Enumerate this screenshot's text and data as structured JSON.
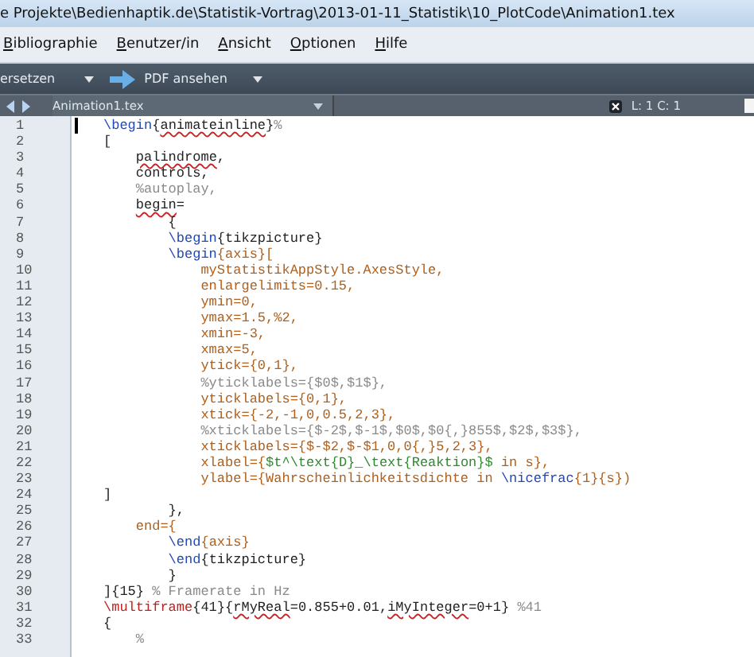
{
  "window": {
    "title": "e Projekte\\Bedienhaptik.de\\Statistik-Vortrag\\2013-01-11_Statistik\\10_PlotCode\\Animation1.tex"
  },
  "menu": [
    "Bibliographie",
    "Benutzer/in",
    "Ansicht",
    "Optionen",
    "Hilfe"
  ],
  "toolbar": [
    {
      "label": "ersetzen",
      "kind": "dropdown"
    },
    {
      "label": "PDF ansehen",
      "kind": "view"
    }
  ],
  "tab": {
    "label": "Animation1.tex",
    "position": "L: 1 C: 1"
  },
  "lines": [
    {
      "number": "1",
      "segments": [
        {
          "t": "\\begin",
          "kind": "cmd"
        },
        {
          "t": "{",
          "kind": "plain"
        },
        {
          "t": "animateinline",
          "kind": "error"
        },
        {
          "t": "}",
          "kind": "plain"
        },
        {
          "t": "%",
          "kind": "comment"
        }
      ]
    },
    {
      "number": "2",
      "segments": [
        {
          "t": "[",
          "kind": "plain"
        }
      ]
    },
    {
      "number": "3",
      "segments": [
        {
          "t": "    palindrome",
          "kind": "error"
        },
        {
          "t": ",",
          "kind": "plain"
        }
      ]
    },
    {
      "number": "4",
      "segments": [
        {
          "t": "    controls,",
          "kind": "plain"
        }
      ]
    },
    {
      "number": "5",
      "segments": [
        {
          "t": "    %autoplay,",
          "kind": "comment"
        }
      ]
    },
    {
      "number": "6",
      "segments": [
        {
          "t": "    begin",
          "kind": "error"
        },
        {
          "t": "=",
          "kind": "plain"
        }
      ]
    },
    {
      "number": "7",
      "segments": [
        {
          "t": "        {",
          "kind": "plain"
        }
      ]
    },
    {
      "number": "8",
      "segments": [
        {
          "t": "        \\begin",
          "kind": "cmd"
        },
        {
          "t": "{tikzpicture}",
          "kind": "plain"
        }
      ]
    },
    {
      "number": "9",
      "segments": [
        {
          "t": "        \\begin",
          "kind": "cmd"
        },
        {
          "t": "{axis}[",
          "kind": "key"
        }
      ]
    },
    {
      "number": "10",
      "segments": [
        {
          "t": "            myStatistikAppStyle.AxesStyle,",
          "kind": "key"
        }
      ]
    },
    {
      "number": "11",
      "segments": [
        {
          "t": "            enlargelimits=0.15,",
          "kind": "key"
        }
      ]
    },
    {
      "number": "12",
      "segments": [
        {
          "t": "            ymin=0,",
          "kind": "key"
        }
      ]
    },
    {
      "number": "13",
      "segments": [
        {
          "t": "            ymax=1.5,%2,",
          "kind": "key"
        }
      ]
    },
    {
      "number": "14",
      "segments": [
        {
          "t": "            xmin=-3,",
          "kind": "key"
        }
      ]
    },
    {
      "number": "15",
      "segments": [
        {
          "t": "            xmax=5,",
          "kind": "key"
        }
      ]
    },
    {
      "number": "16",
      "segments": [
        {
          "t": "            ytick={0,1},",
          "kind": "key"
        }
      ]
    },
    {
      "number": "17",
      "segments": [
        {
          "t": "            %yticklabels={$0$,$1$},",
          "kind": "comment"
        }
      ]
    },
    {
      "number": "18",
      "segments": [
        {
          "t": "            yticklabels={0,1},",
          "kind": "key"
        }
      ]
    },
    {
      "number": "19",
      "segments": [
        {
          "t": "            xtick={-2,-1,0,0.5,2,3},",
          "kind": "key"
        }
      ]
    },
    {
      "number": "20",
      "segments": [
        {
          "t": "            %xticklabels={$-2$,$-1$,$0$,$0{,}855$,$2$,$3$},",
          "kind": "comment"
        }
      ]
    },
    {
      "number": "21",
      "segments": [
        {
          "t": "            xticklabels={$-$2,$-$1,0,0{,}5,2,3},",
          "kind": "key"
        }
      ]
    },
    {
      "number": "22",
      "segments": [
        {
          "t": "            xlabel={",
          "kind": "key"
        },
        {
          "t": "$t^\\text{D}_\\text{Reaktion}$",
          "kind": "math"
        },
        {
          "t": " in s},",
          "kind": "key"
        }
      ]
    },
    {
      "number": "23",
      "segments": [
        {
          "t": "            ylabel={Wahrscheinlichkeitsdichte in ",
          "kind": "key"
        },
        {
          "t": "\\nicefrac",
          "kind": "cmd"
        },
        {
          "t": "{1}{s})",
          "kind": "key"
        }
      ]
    },
    {
      "number": "24",
      "segments": [
        {
          "t": "]",
          "kind": "plain"
        }
      ]
    },
    {
      "number": "25",
      "segments": [
        {
          "t": "        },",
          "kind": "plain"
        }
      ]
    },
    {
      "number": "26",
      "segments": [
        {
          "t": "    end={",
          "kind": "key"
        }
      ]
    },
    {
      "number": "27",
      "segments": [
        {
          "t": "        \\end",
          "kind": "cmd"
        },
        {
          "t": "{axis}",
          "kind": "key"
        }
      ]
    },
    {
      "number": "28",
      "segments": [
        {
          "t": "        \\end",
          "kind": "cmd"
        },
        {
          "t": "{tikzpicture}",
          "kind": "plain"
        }
      ]
    },
    {
      "number": "29",
      "segments": [
        {
          "t": "        }",
          "kind": "plain"
        }
      ]
    },
    {
      "number": "30",
      "segments": [
        {
          "t": "]{15} ",
          "kind": "plain"
        },
        {
          "t": "% Framerate in Hz",
          "kind": "comment"
        }
      ]
    },
    {
      "number": "31",
      "segments": [
        {
          "t": "\\multiframe",
          "kind": "macro"
        },
        {
          "t": "{41}{",
          "kind": "plain"
        },
        {
          "t": "rMyReal",
          "kind": "error"
        },
        {
          "t": "=0.855+0.01,",
          "kind": "plain"
        },
        {
          "t": "iMyInteger",
          "kind": "error"
        },
        {
          "t": "=0+1} ",
          "kind": "plain"
        },
        {
          "t": "%41",
          "kind": "comment"
        }
      ]
    },
    {
      "number": "32",
      "segments": [
        {
          "t": "{",
          "kind": "plain"
        }
      ]
    },
    {
      "number": "33",
      "segments": [
        {
          "t": "    %",
          "kind": "comment"
        }
      ]
    }
  ]
}
